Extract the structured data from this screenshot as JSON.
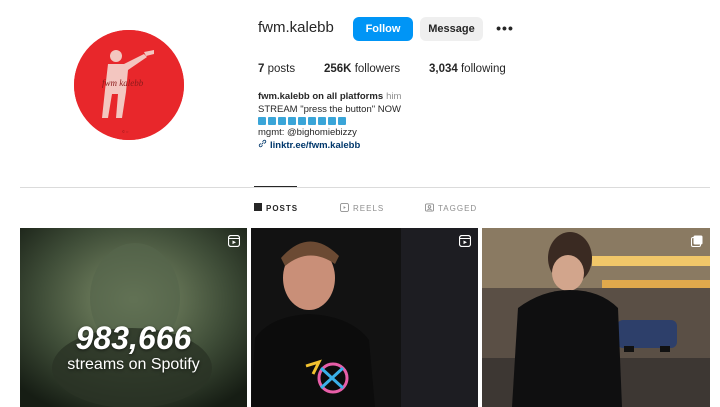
{
  "profile": {
    "username": "fwm.kalebb",
    "follow_label": "Follow",
    "message_label": "Message",
    "more_label": "•••"
  },
  "stats": {
    "posts_count": "7",
    "posts_label": "posts",
    "followers_count": "256K",
    "followers_label": "followers",
    "following_count": "3,034",
    "following_label": "following"
  },
  "bio": {
    "name": "fwm.kalebb on all platforms",
    "pronouns": "him",
    "line1": "STREAM \"press the button\" NOW",
    "line2": "mgmt: @bighomiebizzy",
    "link": "linktr.ee/fwm.kalebb",
    "square_count": 9,
    "square_color": "#3aa5d8"
  },
  "tabs": [
    {
      "label": "POSTS",
      "icon": "grid-icon",
      "active": true
    },
    {
      "label": "REELS",
      "icon": "reels-icon",
      "active": false
    },
    {
      "label": "TAGGED",
      "icon": "tagged-icon",
      "active": false
    }
  ],
  "posts": [
    {
      "type": "reel",
      "overlay_number": "983,666",
      "overlay_text": "streams on Spotify"
    },
    {
      "type": "reel"
    },
    {
      "type": "image"
    }
  ],
  "colors": {
    "accent": "#0095f6",
    "avatar_bg": "#e8272b",
    "link": "#00376b",
    "muted": "#8e8e8e"
  }
}
